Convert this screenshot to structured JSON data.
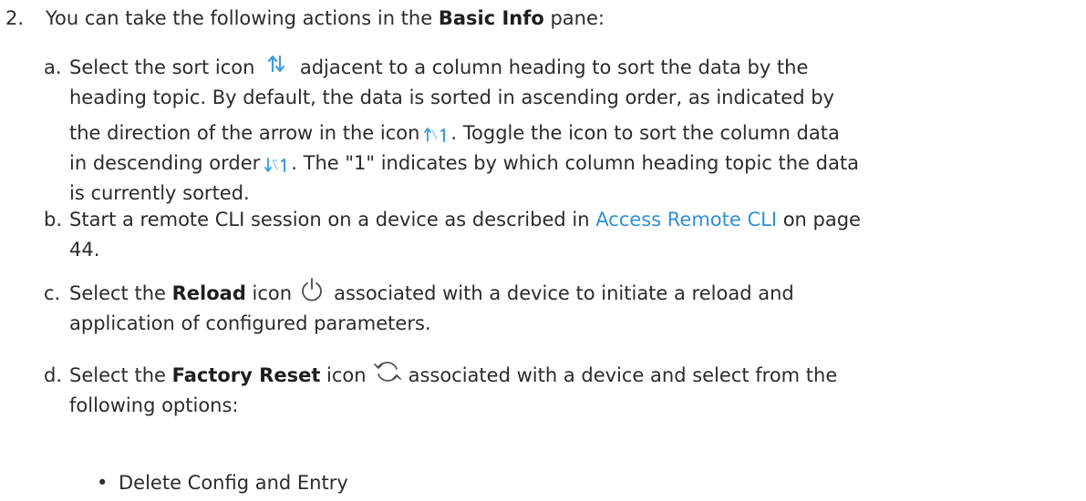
{
  "step": {
    "number": "2.",
    "text_before": "You can take the following actions in the ",
    "pane_name": "Basic Info",
    "text_after": " pane:"
  },
  "items": {
    "a": {
      "letter": "a.",
      "line1_before": "Select the sort icon",
      "line1_after": "adjacent to a column heading to sort the data by the",
      "line2": "heading topic. By default, the data is sorted in ascending order, as indicated by",
      "line3_before": "the direction of the arrow in the icon",
      "line3_after": ". Toggle the icon to sort the column data",
      "line4_before": "in descending order",
      "line4_after": ". The \"1\" indicates by which column heading topic the data",
      "line5": "is currently sorted."
    },
    "b": {
      "letter": "b.",
      "text_before": "Start a remote CLI session on a device as described in ",
      "link_text": "Access Remote CLI",
      "text_after": " on page",
      "line2": "44."
    },
    "c": {
      "letter": "c.",
      "text_before": "Select the ",
      "bold": "Reload",
      "text_mid": " icon",
      "text_after": "associated with a device to initiate a reload and",
      "line2": "application of configured parameters."
    },
    "d": {
      "letter": "d.",
      "text_before": "Select the ",
      "bold": "Factory Reset",
      "text_mid": " icon",
      "text_after": "associated with a device and select from the",
      "line2": "following options:"
    }
  },
  "bullet": {
    "symbol": "•",
    "text": "Delete Config and Entry"
  },
  "colors": {
    "body_text": "#2b2b2b",
    "link": "#2f8fd8",
    "icon_blue": "#3a9be6",
    "icon_gray": "#4a4a4a"
  },
  "icons": {
    "sort": "sort-icon",
    "sort_ascending": "sort-ascending-icon",
    "sort_descending": "sort-descending-icon",
    "reload": "power-icon",
    "factory_reset": "refresh-icon"
  }
}
